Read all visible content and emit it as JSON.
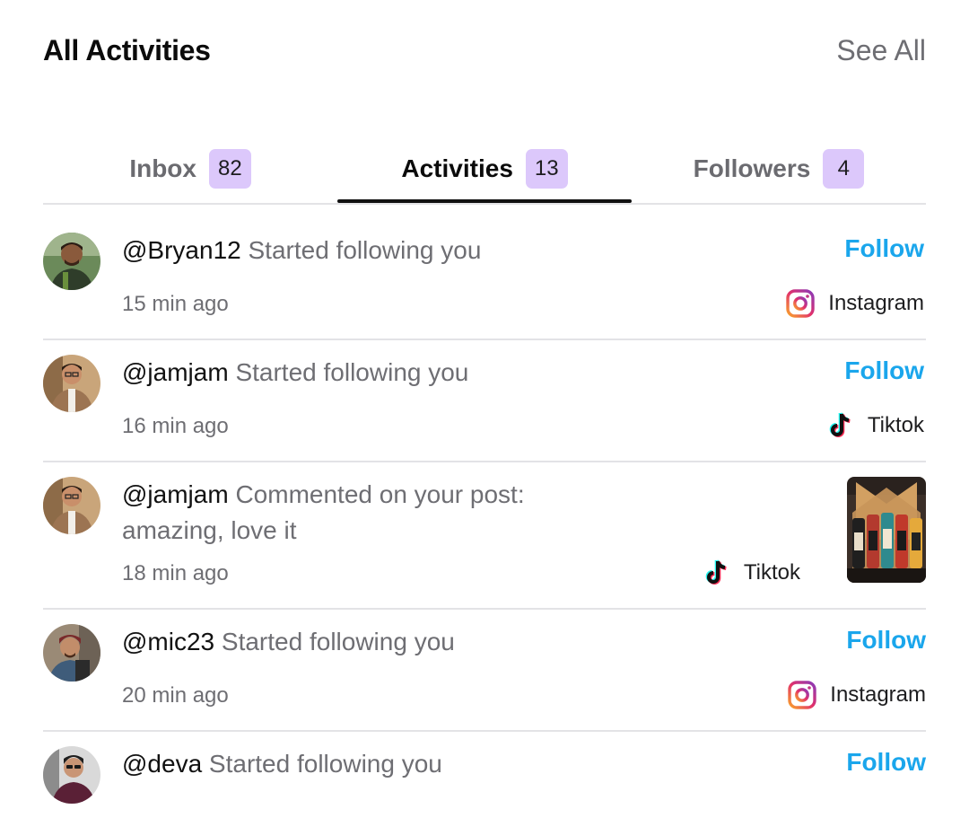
{
  "header": {
    "title": "All Activities",
    "see_all": "See All"
  },
  "tabs": [
    {
      "label": "Inbox",
      "count": "82"
    },
    {
      "label": "Activities",
      "count": "13"
    },
    {
      "label": "Followers",
      "count": "4"
    }
  ],
  "active_tab": "Activities",
  "activities": [
    {
      "handle": "@Bryan12",
      "action": "Started following you",
      "time": "15 min ago",
      "follow": "Follow",
      "platform": "Instagram"
    },
    {
      "handle": "@jamjam",
      "action": "Started following you",
      "time": "16 min ago",
      "follow": "Follow",
      "platform": "Tiktok"
    },
    {
      "handle": "@jamjam",
      "action": "Commented on your post:",
      "comment": "amazing, love it",
      "time": "18 min ago",
      "platform": "Tiktok"
    },
    {
      "handle": "@mic23",
      "action": "Started following you",
      "time": "20 min ago",
      "follow": "Follow",
      "platform": "Instagram"
    },
    {
      "handle": "@deva",
      "action": "Started following you",
      "follow": "Follow"
    }
  ],
  "colors": {
    "badge_bg": "#dcc8fb",
    "follow": "#1aa6ec",
    "muted_text": "#6e6e73",
    "divider": "#e3e3e6"
  },
  "icons": {
    "instagram": "instagram-icon",
    "tiktok": "tiktok-icon"
  }
}
